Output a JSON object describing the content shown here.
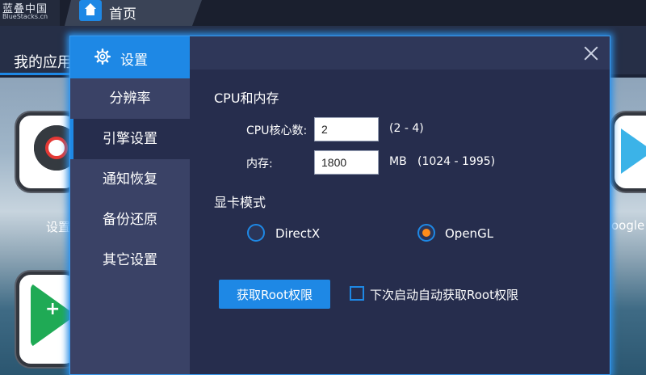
{
  "topbar": {
    "logo_line1": "蓝叠中国",
    "logo_line2": "BlueStacks.cn",
    "home_tab": "首页"
  },
  "background": {
    "my_apps_label": "我的应用",
    "apps": [
      {
        "label": "设置",
        "icon": "settings-icon"
      },
      {
        "label": "oogle",
        "icon": "play-store-icon"
      },
      {
        "label": "",
        "icon": "games-icon"
      }
    ]
  },
  "dialog": {
    "title": "设置",
    "sidebar": [
      {
        "label": "分辨率",
        "active": false
      },
      {
        "label": "引擎设置",
        "active": true
      },
      {
        "label": "通知恢复",
        "active": false
      },
      {
        "label": "备份还原",
        "active": false
      },
      {
        "label": "其它设置",
        "active": false
      }
    ],
    "cpu_section": {
      "heading": "CPU和内存",
      "cpu_label": "CPU核心数:",
      "cpu_value": "2",
      "cpu_range": "(2 - 4)",
      "mem_label": "内存:",
      "mem_value": "1800",
      "mem_unit": "MB",
      "mem_range": "(1024 - 1995)"
    },
    "gpu_section": {
      "heading": "显卡模式",
      "options": [
        {
          "label": "DirectX",
          "selected": false
        },
        {
          "label": "OpenGL",
          "selected": true
        }
      ]
    },
    "root": {
      "button_label": "获取Root权限",
      "checkbox_label": "下次启动自动获取Root权限",
      "checked": false
    }
  },
  "colors": {
    "accent": "#1e88e5",
    "dialog_bg": "#262d4d",
    "sidebar_bg": "#3a4266",
    "radio_selected": "#ff8c1a"
  }
}
